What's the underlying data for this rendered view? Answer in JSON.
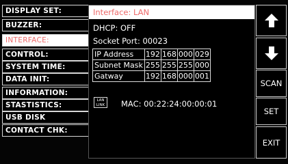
{
  "menu": {
    "items": [
      {
        "label": "DISPLAY SET:",
        "active": false
      },
      {
        "label": "BUZZER:",
        "active": false
      },
      {
        "label": "INTERFACE:",
        "active": true
      },
      {
        "label": "CONTROL:",
        "active": false
      },
      {
        "label": "SYSTEM TIME:",
        "active": false
      },
      {
        "label": "DATA INIT:",
        "active": false
      },
      {
        "label": "INFORMATION:",
        "active": false
      },
      {
        "label": "STASTISTICS:",
        "active": false
      },
      {
        "label": "USB DISK",
        "active": false
      },
      {
        "label": "CONTACT CHK:",
        "active": false
      }
    ]
  },
  "panel": {
    "header": "Interface: LAN",
    "dhcp": "DHCP: OFF",
    "socket_port": "Socket Port: 00023",
    "network_table": [
      {
        "label": "IP Address",
        "octets": [
          "192",
          "168",
          "000",
          "029"
        ]
      },
      {
        "label": "Subnet Mask",
        "octets": [
          "255",
          "255",
          "255",
          "000"
        ]
      },
      {
        "label": "Gatway",
        "octets": [
          "192",
          "168",
          "000",
          "001"
        ]
      }
    ],
    "lan_icon_line1": "LAN",
    "lan_icon_line2": "LINK",
    "mac": "MAC: 00:22:24:00:00:01"
  },
  "buttons": {
    "up_icon": "arrow-up-icon",
    "down_icon": "arrow-down-icon",
    "scan": "SCAN",
    "set": "SET",
    "exit": "EXIT"
  },
  "colors": {
    "background": "#000000",
    "border": "#d8d8d8",
    "highlight_bg": "#ffffff",
    "highlight_text": "#ee6a6a",
    "text": "#ffffff"
  }
}
